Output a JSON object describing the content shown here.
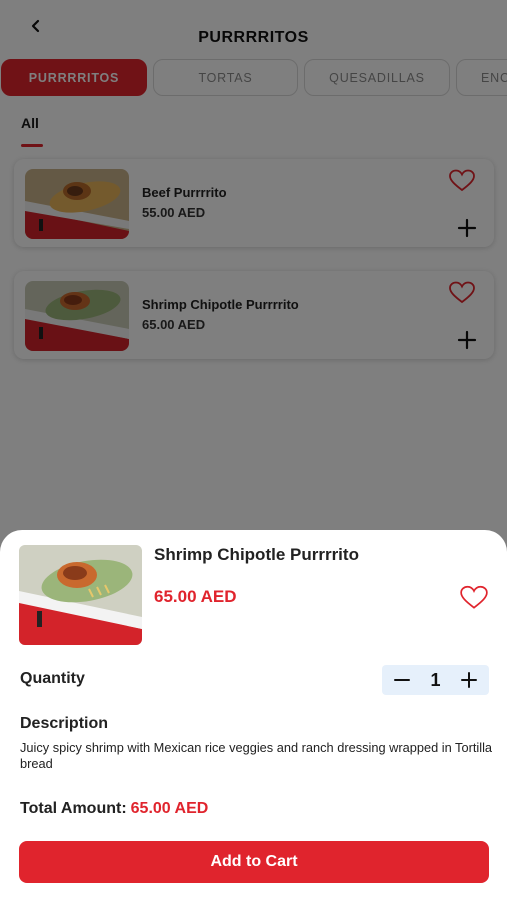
{
  "header": {
    "title": "PURRRRITOS",
    "back_icon": "chevron-left-icon"
  },
  "tabs": [
    {
      "label": "PURRRRITOS",
      "active": true
    },
    {
      "label": "TORTAS",
      "active": false
    },
    {
      "label": "QUESADILLAS",
      "active": false
    },
    {
      "label": "ENC",
      "active": false
    }
  ],
  "filter": {
    "label": "All"
  },
  "products": [
    {
      "name": "Beef Purrrrito",
      "price": "55.00 AED"
    },
    {
      "name": "Shrimp Chipotle Purrrrito",
      "price": "65.00 AED"
    }
  ],
  "sheet": {
    "name": "Shrimp Chipotle Purrrrito",
    "price": "65.00 AED",
    "quantity_label": "Quantity",
    "quantity": "1",
    "description_label": "Description",
    "description": "Juicy spicy shrimp with Mexican rice veggies and ranch dressing wrapped in Tortilla bread",
    "total_label": "Total Amount:",
    "total_amount": "65.00 AED",
    "add_to_cart_label": "Add to Cart"
  },
  "colors": {
    "accent": "#e0242d",
    "stepper_bg": "#e6f0fb",
    "overlay": "#000000"
  }
}
